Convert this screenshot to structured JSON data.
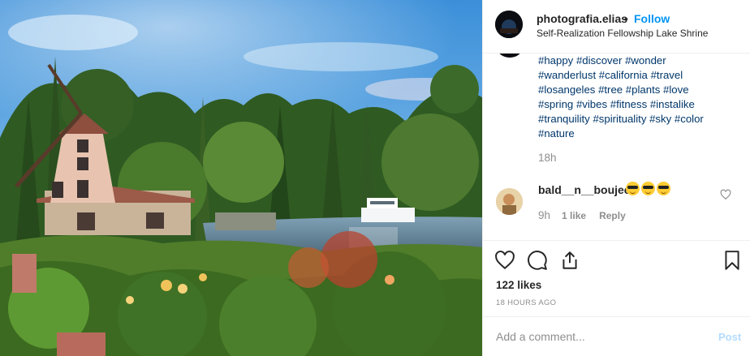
{
  "photo": {
    "subject": "windmill-lake-garden",
    "colors": {
      "sky_top": "#3b8fd9",
      "sky_bottom": "#a8d4f0",
      "lake": "#5c7a8f",
      "foliage": "#3d6b2a"
    }
  },
  "post": {
    "username": "photografia.elias",
    "separator": "•",
    "follow_label": "Follow",
    "location": "Self-Realization Fellowship Lake Shrine",
    "hashtags": [
      "#happy",
      "#discover",
      "#wonder",
      "#wanderlust",
      "#california",
      "#travel",
      "#losangeles",
      "#tree",
      "#plants",
      "#love",
      "#spring",
      "#vibes",
      "#fitness",
      "#instalike",
      "#tranquility",
      "#spirituality",
      "#sky",
      "#color",
      "#nature"
    ],
    "caption_time": "18h",
    "likes_text": "122 likes",
    "posted_ago": "18 HOURS AGO"
  },
  "comment": {
    "username": "bald__n__boujee",
    "emoji_icons": [
      "sunglasses-face-icon",
      "sunglasses-face-icon",
      "sunglasses-face-icon"
    ],
    "time": "9h",
    "likes": "1 like",
    "reply_label": "Reply"
  },
  "actions": {
    "icons": [
      "heart-icon",
      "comment-icon",
      "share-icon",
      "bookmark-icon"
    ]
  },
  "add_comment": {
    "placeholder": "Add a comment...",
    "post_label": "Post"
  },
  "colors": {
    "link": "#00376b",
    "accent": "#0095f6",
    "muted": "#8e8e8e",
    "post_disabled": "#b3dbff"
  }
}
